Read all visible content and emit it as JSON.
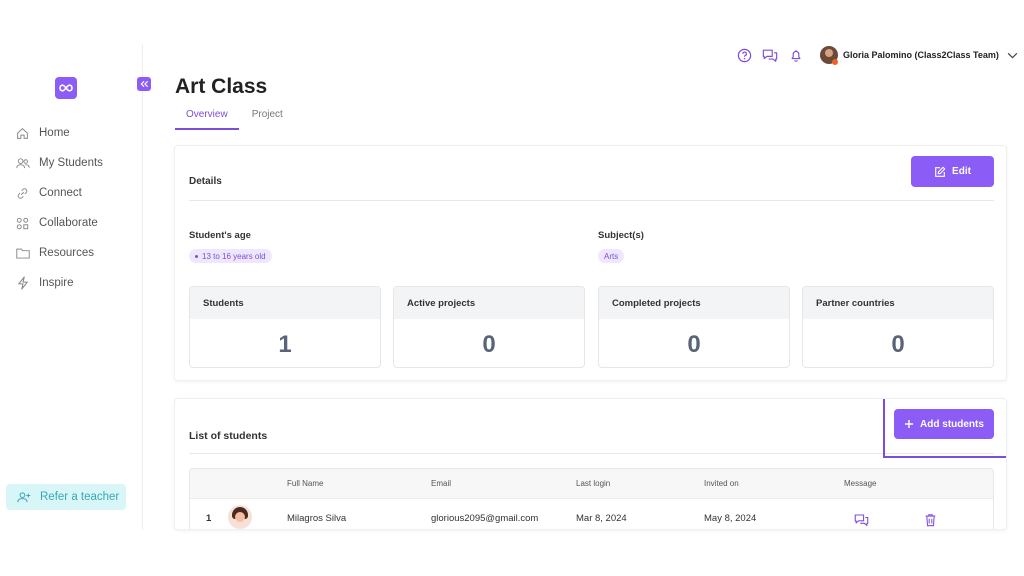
{
  "brand": {
    "accent": "#8b5cf6",
    "accent_dark": "#7c4ddb",
    "refer_bg": "#d8f6f7",
    "refer_fg": "#3aa7b4",
    "logo_icon": "infinity-icon"
  },
  "sidebar": {
    "items": [
      {
        "label": "Home",
        "icon": "home-icon"
      },
      {
        "label": "My Students",
        "icon": "users-icon"
      },
      {
        "label": "Connect",
        "icon": "link-icon"
      },
      {
        "label": "Collaborate",
        "icon": "grid-icon"
      },
      {
        "label": "Resources",
        "icon": "folder-icon"
      },
      {
        "label": "Inspire",
        "icon": "lightning-icon"
      }
    ],
    "refer_label": "Refer a teacher"
  },
  "header": {
    "icons": [
      "help-icon",
      "chat-icon",
      "bell-icon"
    ],
    "user_name": "Gloria Palomino (Class2Class Team)"
  },
  "page": {
    "title": "Art Class",
    "tabs": [
      {
        "label": "Overview",
        "active": true
      },
      {
        "label": "Project",
        "active": false
      }
    ]
  },
  "details": {
    "title": "Details",
    "edit_label": "Edit",
    "age_label": "Student's age",
    "age_value": "13 to 16 years old",
    "subject_label": "Subject(s)",
    "subject_value": "Arts",
    "stats": [
      {
        "label": "Students",
        "value": "1"
      },
      {
        "label": "Active projects",
        "value": "0"
      },
      {
        "label": "Completed projects",
        "value": "0"
      },
      {
        "label": "Partner countries",
        "value": "0"
      }
    ]
  },
  "students": {
    "title": "List of students",
    "add_label": "Add students",
    "columns": [
      "Full Name",
      "Email",
      "Last login",
      "Invited on",
      "Message"
    ],
    "rows": [
      {
        "num": "1",
        "name": "Milagros Silva",
        "email": "glorious2095@gmail.com",
        "last_login": "Mar 8, 2024",
        "invited_on": "May 8, 2024"
      }
    ]
  }
}
